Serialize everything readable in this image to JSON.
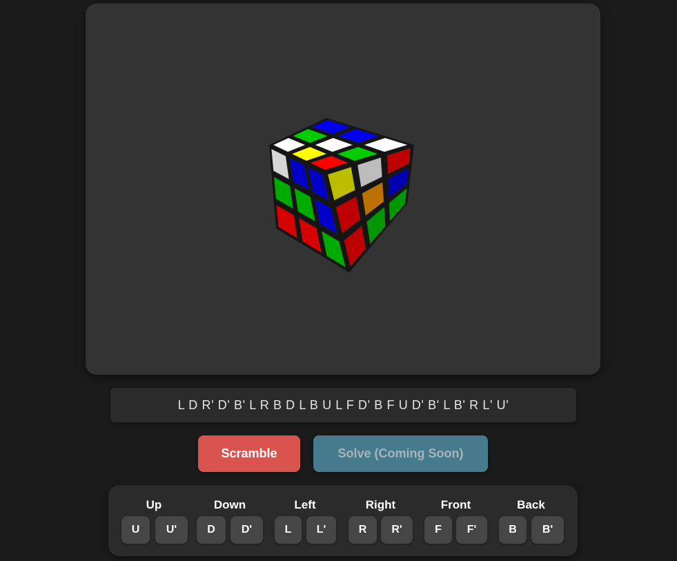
{
  "cube": {
    "colors": {
      "W": "#ffffff",
      "Y": "#ffff00",
      "R": "#ff0000",
      "O": "#ff9900",
      "G": "#00cc00",
      "B": "#0000ee"
    },
    "faces": {
      "top": [
        [
          "B",
          "B",
          "W"
        ],
        [
          "G",
          "W",
          "G"
        ],
        [
          "W",
          "Y",
          "R"
        ]
      ],
      "left": [
        [
          "W",
          "B",
          "B"
        ],
        [
          "G",
          "G",
          "B"
        ],
        [
          "R",
          "R",
          "G"
        ]
      ],
      "right": [
        [
          "Y",
          "W",
          "R"
        ],
        [
          "R",
          "O",
          "B"
        ],
        [
          "R",
          "G",
          "G"
        ]
      ]
    }
  },
  "sequence": "L D R' D' B' L R B D L B U L F D' B F U D' B' L B' R L' U'",
  "actions": {
    "scramble_label": "Scramble",
    "solve_label": "Solve (Coming Soon)"
  },
  "controls": {
    "groups": [
      {
        "label": "Up",
        "moves": [
          "U",
          "U'"
        ]
      },
      {
        "label": "Down",
        "moves": [
          "D",
          "D'"
        ]
      },
      {
        "label": "Left",
        "moves": [
          "L",
          "L'"
        ]
      },
      {
        "label": "Right",
        "moves": [
          "R",
          "R'"
        ]
      },
      {
        "label": "Front",
        "moves": [
          "F",
          "F'"
        ]
      },
      {
        "label": "Back",
        "moves": [
          "B",
          "B'"
        ]
      }
    ]
  }
}
